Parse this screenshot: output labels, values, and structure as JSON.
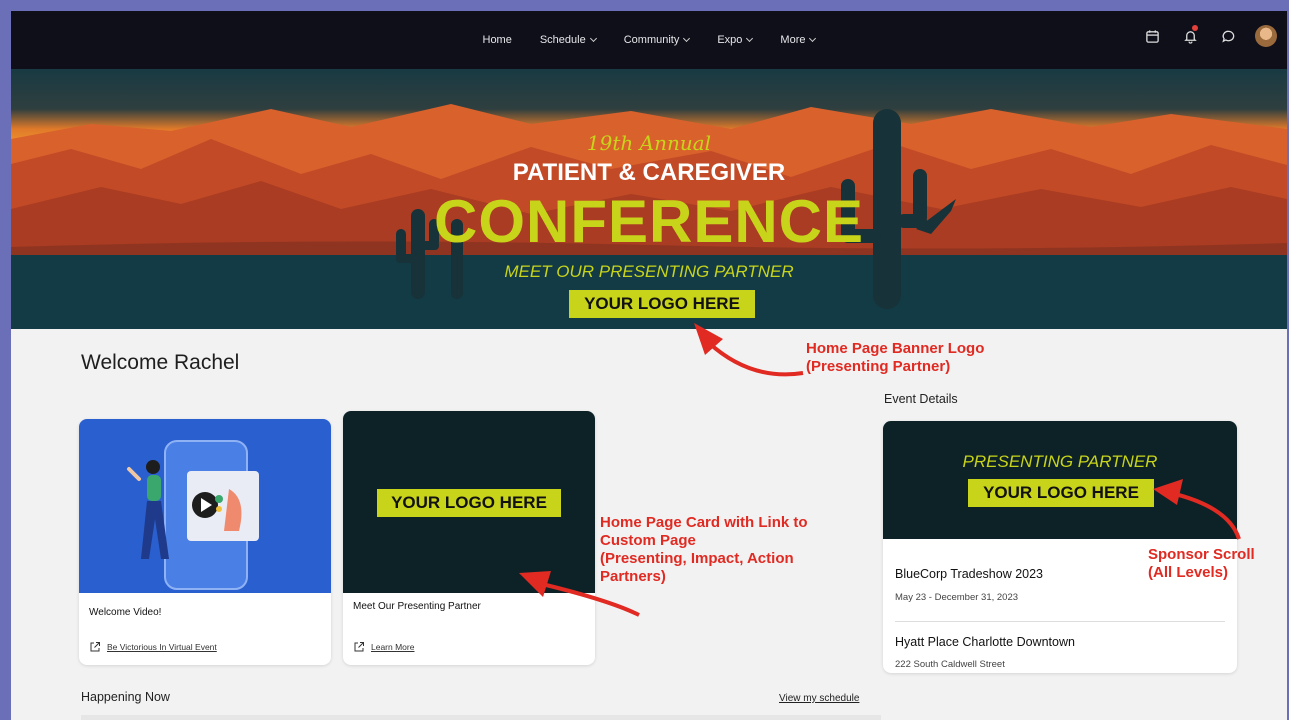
{
  "nav": {
    "items": [
      {
        "label": "Home",
        "dropdown": false
      },
      {
        "label": "Schedule",
        "dropdown": true
      },
      {
        "label": "Community",
        "dropdown": true
      },
      {
        "label": "Expo",
        "dropdown": true
      },
      {
        "label": "More",
        "dropdown": true
      }
    ],
    "icons": [
      "calendar-icon",
      "bell-icon",
      "chat-icon",
      "avatar"
    ]
  },
  "banner": {
    "annual": "19th Annual",
    "line1": "PATIENT & CAREGIVER",
    "line2": "CONFERENCE",
    "meet": "MEET OUR PRESENTING PARTNER",
    "logo": "YOUR LOGO HERE"
  },
  "welcome": "Welcome Rachel",
  "annotations": {
    "banner_logo": [
      "Home Page Banner Logo",
      "(Presenting Partner)"
    ],
    "card": [
      "Home Page Card with Link to",
      "Custom Page",
      "(Presenting, Impact, Action",
      "Partners)"
    ],
    "sponsor": [
      "Sponsor Scroll",
      "(All Levels)"
    ]
  },
  "cards": [
    {
      "title": "Welcome Video!",
      "link": "Be Victorious In Virtual Event"
    },
    {
      "title": "Meet Our Presenting Partner",
      "link": "Learn More",
      "logo": "YOUR LOGO HERE"
    }
  ],
  "event_details": {
    "label": "Event Details",
    "sponsor_heading": "PRESENTING PARTNER",
    "sponsor_logo": "YOUR LOGO HERE",
    "event_name": "BlueCorp Tradeshow 2023",
    "event_dates": "May 23 - December 31, 2023",
    "venue": "Hyatt Place Charlotte Downtown",
    "address": "222 South Caldwell Street"
  },
  "happening_now": "Happening Now",
  "view_schedule": "View my schedule",
  "colors": {
    "accent": "#c8d41a",
    "annotation": "#e02a22",
    "nav_bg": "#0f0f1a",
    "card_dark": "#0d2226",
    "video_bg": "#2a5fcf",
    "frame": "#6b6fb8"
  }
}
